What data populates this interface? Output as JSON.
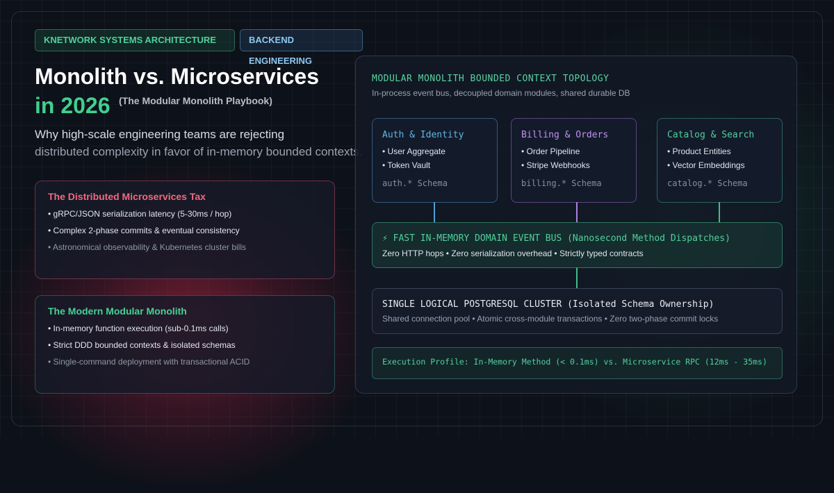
{
  "tags": {
    "primary": "KNETWORK SYSTEMS ARCHITECTURE",
    "secondary": "BACKEND ENGINEERING"
  },
  "hero": {
    "title_line1": "Monolith vs. Microservices",
    "title_line2": "in 2026",
    "subtitle": "(The Modular Monolith Playbook)",
    "description_line1": "Why high-scale engineering teams are rejecting",
    "description_line2": "distributed complexity in favor of in-memory bounded contexts."
  },
  "cards": {
    "microservices": {
      "title": "The Distributed Microservices Tax",
      "items": [
        "• gRPC/JSON serialization latency (5-30ms / hop)",
        "• Complex 2-phase commits & eventual consistency",
        "• Astronomical observability & Kubernetes cluster bills"
      ]
    },
    "monolith": {
      "title": "The Modern Modular Monolith",
      "items": [
        "• In-memory function execution (sub-0.1ms calls)",
        "• Strict DDD bounded contexts & isolated schemas",
        "• Single-command deployment with transactional ACID"
      ]
    }
  },
  "topology": {
    "title": "MODULAR MONOLITH BOUNDED CONTEXT TOPOLOGY",
    "subtitle": "In-process event bus, decoupled domain modules, shared durable DB",
    "modules": [
      {
        "title": "Auth & Identity",
        "items": [
          "• User Aggregate",
          "• Token Vault"
        ],
        "schema": "auth.* Schema",
        "color": "#62b6e6"
      },
      {
        "title": "Billing & Orders",
        "items": [
          "• Order Pipeline",
          "• Stripe Webhooks"
        ],
        "schema": "billing.* Schema",
        "color": "#c58ff0"
      },
      {
        "title": "Catalog & Search",
        "items": [
          "• Product Entities",
          "• Vector Embeddings"
        ],
        "schema": "catalog.* Schema",
        "color": "#4fd19a"
      }
    ],
    "bus": {
      "title": "⚡ FAST IN-MEMORY DOMAIN EVENT BUS (Nanosecond Method Dispatches)",
      "subtitle": "Zero HTTP hops • Zero serialization overhead • Strictly typed contracts"
    },
    "database": {
      "title": "SINGLE LOGICAL POSTGRESQL CLUSTER (Isolated Schema Ownership)",
      "subtitle": "Shared connection pool • Atomic cross-module transactions • Zero two-phase commit locks"
    },
    "execution_profile": "Execution Profile: In-Memory Method (< 0.1ms) vs. Microservice RPC (12ms - 35ms)"
  },
  "colors": {
    "accent_green": "#4fd19a",
    "accent_blue": "#62b6e6",
    "accent_purple": "#c58ff0",
    "accent_red": "#f06a80",
    "background": "#0d1119"
  }
}
